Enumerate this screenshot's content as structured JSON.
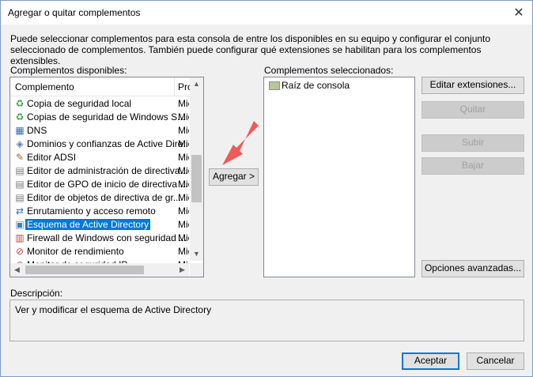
{
  "window": {
    "title": "Agregar o quitar complementos",
    "close_glyph": "✕"
  },
  "intro_text": "Puede seleccionar complementos para esta consola de entre los disponibles en su equipo y configurar el conjunto seleccionado de complementos. También puede configurar qué extensiones se habilitan para los complementos extensibles.",
  "available": {
    "label": "Complementos disponibles:",
    "columns": [
      "Complemento",
      "Pro"
    ],
    "items": [
      {
        "name": "Copia de seguridad local",
        "provider": "Mic",
        "icon": "backup-icon"
      },
      {
        "name": "Copias de seguridad de Windows S...",
        "provider": "Mic",
        "icon": "backup-icon"
      },
      {
        "name": "DNS",
        "provider": "Mic",
        "icon": "dns-icon"
      },
      {
        "name": "Dominios y confianzas de Active Dire...",
        "provider": "Mic",
        "icon": "domains-icon"
      },
      {
        "name": "Editor ADSI",
        "provider": "Mic",
        "icon": "adsi-icon"
      },
      {
        "name": "Editor de administración de directiva...",
        "provider": "Mic",
        "icon": "policy-icon"
      },
      {
        "name": "Editor de GPO de inicio de directiva ...",
        "provider": "Mic",
        "icon": "policy-icon"
      },
      {
        "name": "Editor de objetos de directiva de gr...",
        "provider": "Mic",
        "icon": "policy-icon"
      },
      {
        "name": "Enrutamiento y acceso remoto",
        "provider": "Mic",
        "icon": "routing-icon"
      },
      {
        "name": "Esquema de Active Directory",
        "provider": "Mic",
        "icon": "schema-icon",
        "selected": true
      },
      {
        "name": "Firewall de Windows con seguridad ...",
        "provider": "Mic",
        "icon": "firewall-icon"
      },
      {
        "name": "Monitor de rendimiento",
        "provider": "Mic",
        "icon": "monitor-icon"
      },
      {
        "name": "Monitor de seguridad IP",
        "provider": "Mic",
        "icon": "monitor-icon"
      }
    ]
  },
  "add_button": "Agregar >",
  "selected": {
    "label": "Complementos seleccionados:",
    "items": [
      {
        "name": "Raíz de consola",
        "icon": "folder-icon"
      }
    ]
  },
  "side_buttons": {
    "edit_extensions": "Editar extensiones...",
    "remove": "Quitar",
    "up": "Subir",
    "down": "Bajar",
    "advanced": "Opciones avanzadas..."
  },
  "description": {
    "label": "Descripción:",
    "text": "Ver y modificar el esquema de Active Directory"
  },
  "footer": {
    "ok": "Aceptar",
    "cancel": "Cancelar"
  },
  "colors": {
    "selection": "#0078d7",
    "annotation_arrow": "#f05a5a"
  }
}
